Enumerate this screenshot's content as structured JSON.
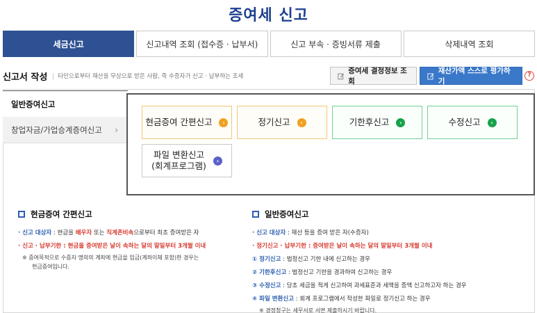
{
  "page_title": "증여세 신고",
  "tabs": [
    {
      "label": "세금신고"
    },
    {
      "label": "신고내역 조회 (접수증 · 납부서)"
    },
    {
      "label": "신고 부속 · 증빙서류 제출"
    },
    {
      "label": "삭제내역 조회"
    }
  ],
  "section": {
    "title": "신고서 작성",
    "desc": "타인으로부터 재산을 무상으로 받은 사람, 즉 수증자가 신고 · 납부하는 조세",
    "btn_gift": "증여세 결정정보 조회",
    "btn_self": "재산가액 스스로 평가하기",
    "help": "?"
  },
  "side": [
    {
      "label": "일반증여신고"
    },
    {
      "label": "창업자금/가업승계증여신고",
      "chev": "›"
    }
  ],
  "cards": [
    {
      "label": "현금증여 간편신고"
    },
    {
      "label": "정기신고"
    },
    {
      "label": "기한후신고"
    },
    {
      "label": "수정신고"
    },
    {
      "line1": "파일 변환신고",
      "line2": "(회계프로그램)"
    }
  ],
  "left_info": {
    "title": "현금증여 간편신고",
    "l1_label": "· 신고 대상자",
    "l1_a": " : 현금을 ",
    "l1_red1": "배우자",
    "l1_b": " 또는 ",
    "l1_red2": "직계존비속",
    "l1_c": "으로부터 최초 증여받은 자",
    "l2_label": "· 신고 · 납부기한",
    "l2_red": " : 현금을 증여받은 날이 속하는 달의 말일부터 3개월 이내",
    "note1": "※ 증여목적으로 수증자 명의의 계좌에 현금을 입금(계좌이체 포함)한 경우는",
    "note2": "현금증여입니다."
  },
  "right_info": {
    "title": "일반증여신고",
    "l1_label": "· 신고 대상자",
    "l1_text": " : 재산 등을 증여 받은 자(수증자)",
    "l2_label": "· 정기신고 · 납부기한",
    "l2_red": " : 증여받은 날이 속하는 달의 말일부터 3개월 이내",
    "l3_label": "① 정기신고",
    "l3_text": " : 법정신고 기한 내에 신고하는 경우",
    "l4_label": "② 기한후신고",
    "l4_text": " : 법정신고 기한을 경과하여 신고하는 경우",
    "l5_label": "③ 수정신고",
    "l5_text": " : 당초 세금을 적게 신고하여 과세표준과 세액을 증액 신고하고자 하는 경우",
    "l6_label": "④ 파일 변환신고",
    "l6_text": " : 회계 프로그램에서 작성한 파일로 정기신고 하는 경우",
    "note": "※ 경정청구는 세무서로 서면 제출하시기 바랍니다."
  },
  "colors": {
    "primary": "#2d5192",
    "accent_blue": "#3a78c9",
    "red": "#d63a2f",
    "orange": "#f0a020",
    "green": "#18a24a",
    "purple": "#5b63c9"
  }
}
